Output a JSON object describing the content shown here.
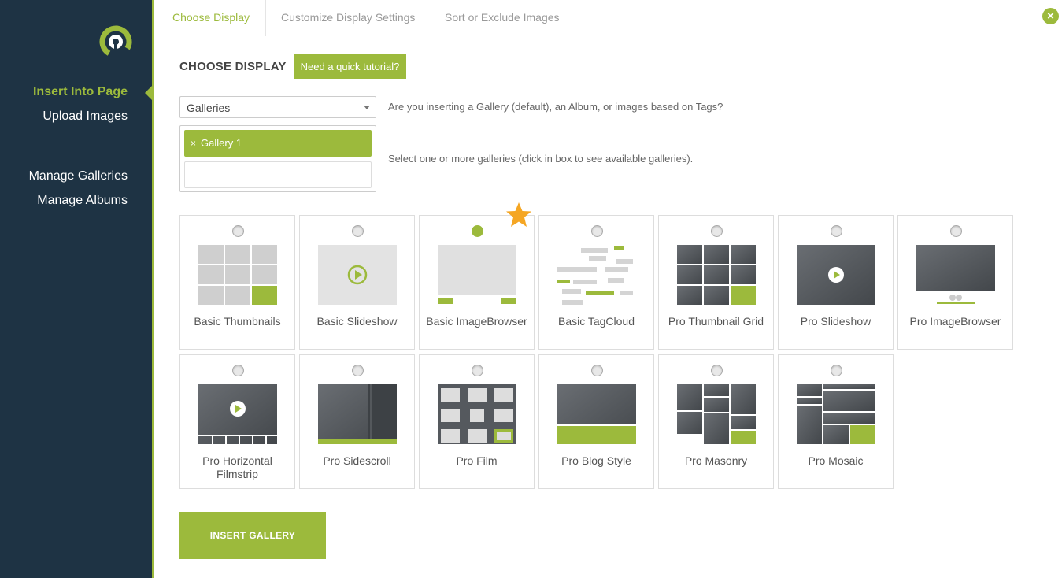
{
  "sidebar": {
    "items": [
      {
        "label": "Insert Into Page",
        "active": true
      },
      {
        "label": "Upload Images",
        "active": false
      },
      {
        "label": "Manage Galleries",
        "active": false
      },
      {
        "label": "Manage Albums",
        "active": false
      }
    ]
  },
  "tabs": [
    {
      "label": "Choose Display",
      "active": true
    },
    {
      "label": "Customize Display Settings",
      "active": false
    },
    {
      "label": "Sort or Exclude Images",
      "active": false
    }
  ],
  "close_icon": "×",
  "main": {
    "title": "CHOOSE DISPLAY",
    "tutorial_label": "Need a quick tutorial?",
    "source_select": {
      "value": "Galleries",
      "help": "Are you inserting a Gallery (default), an Album, or images based on Tags?"
    },
    "gallery_picker": {
      "selected": [
        {
          "label": "Gallery 1",
          "remove": "×"
        }
      ],
      "help": "Select one or more galleries (click in box to see available galleries)."
    },
    "displays": [
      {
        "label": "Basic Thumbnails",
        "selected": false,
        "icon": "basic-thumbnails"
      },
      {
        "label": "Basic Slideshow",
        "selected": false,
        "icon": "basic-slideshow"
      },
      {
        "label": "Basic ImageBrowser",
        "selected": true,
        "icon": "basic-imagebrowser"
      },
      {
        "label": "Basic TagCloud",
        "selected": false,
        "icon": "basic-tagcloud"
      },
      {
        "label": "Pro Thumbnail Grid",
        "selected": false,
        "icon": "pro-thumbnail-grid"
      },
      {
        "label": "Pro Slideshow",
        "selected": false,
        "icon": "pro-slideshow"
      },
      {
        "label": "Pro ImageBrowser",
        "selected": false,
        "icon": "pro-imagebrowser"
      },
      {
        "label": "Pro Horizontal Filmstrip",
        "selected": false,
        "icon": "pro-horizontal-filmstrip"
      },
      {
        "label": "Pro Sidescroll",
        "selected": false,
        "icon": "pro-sidescroll"
      },
      {
        "label": "Pro Film",
        "selected": false,
        "icon": "pro-film"
      },
      {
        "label": "Pro Blog Style",
        "selected": false,
        "icon": "pro-blog-style"
      },
      {
        "label": "Pro Masonry",
        "selected": false,
        "icon": "pro-masonry"
      },
      {
        "label": "Pro Mosaic",
        "selected": false,
        "icon": "pro-mosaic"
      }
    ],
    "insert_label": "INSERT GALLERY"
  },
  "colors": {
    "accent": "#9cba3c",
    "sidebar": "#1e3344",
    "star": "#f5a623"
  }
}
